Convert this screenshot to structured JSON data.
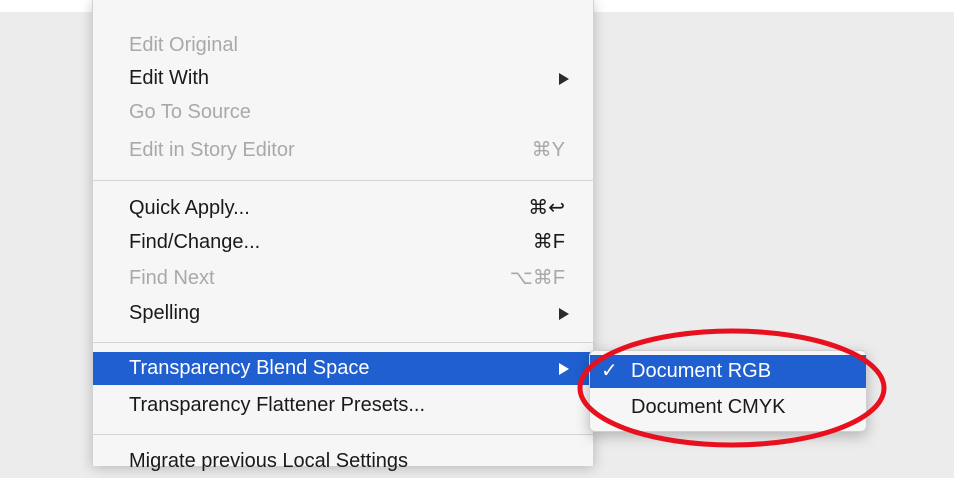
{
  "menu": {
    "group1": [
      {
        "label": "Edit Original",
        "shortcut": "",
        "disabled": true
      },
      {
        "label": "Edit With",
        "shortcut": "",
        "disabled": false,
        "submenu": true
      },
      {
        "label": "Go To Source",
        "shortcut": "",
        "disabled": true
      },
      {
        "label": "Edit in Story Editor",
        "shortcut": "⌘Y",
        "disabled": true
      }
    ],
    "group2": [
      {
        "label": "Quick Apply...",
        "shortcut": "⌘↩",
        "disabled": false
      },
      {
        "label": "Find/Change...",
        "shortcut": "⌘F",
        "disabled": false
      },
      {
        "label": "Find Next",
        "shortcut": "⌥⌘F",
        "disabled": true
      },
      {
        "label": "Spelling",
        "shortcut": "",
        "disabled": false,
        "submenu": true
      }
    ],
    "group3": [
      {
        "label": "Transparency Blend Space",
        "selected": true,
        "submenu": true
      },
      {
        "label": "Transparency Flattener Presets...",
        "selected": false
      }
    ],
    "group4": [
      {
        "label": "Migrate previous Local Settings"
      }
    ]
  },
  "submenu": {
    "items": [
      {
        "label": "Document RGB",
        "checked": true,
        "check": "✓"
      },
      {
        "label": "Document CMYK",
        "checked": false,
        "check": ""
      }
    ]
  },
  "annotation": {
    "color": "#e8101e",
    "shape": "ellipse-highlight"
  },
  "colors": {
    "selection": "#1f5fcf",
    "menu_bg": "#f6f6f6",
    "disabled_text": "#a9a9a9"
  }
}
